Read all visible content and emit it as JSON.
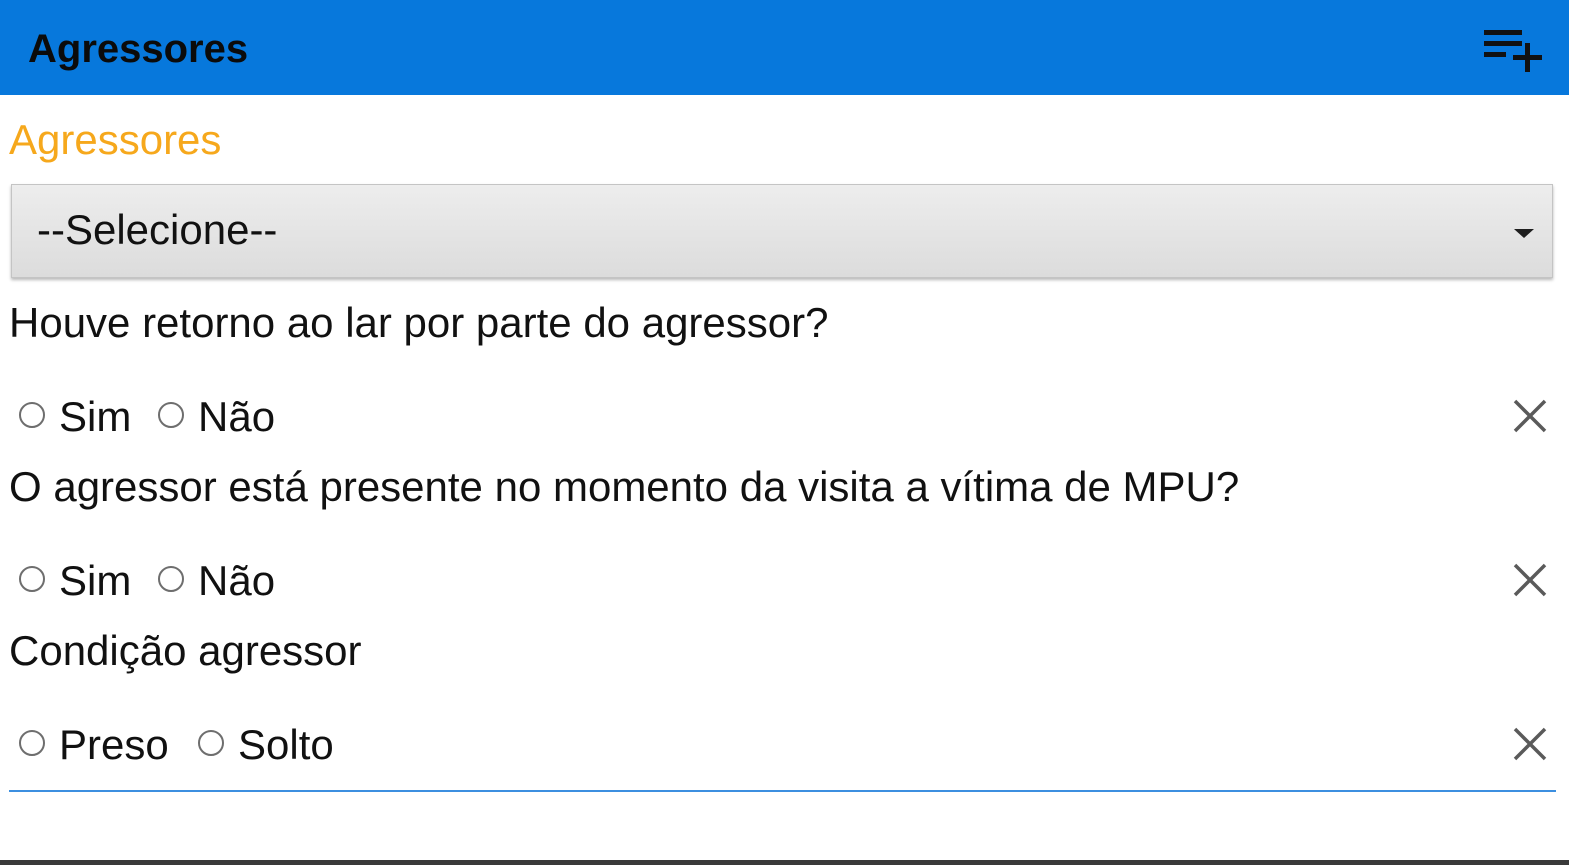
{
  "app_bar": {
    "title": "Agressores",
    "action_icon": "playlist-add-icon",
    "background_color": "#0778dc"
  },
  "section": {
    "title": "Agressores",
    "title_color": "#f6a81c"
  },
  "aggressor_select": {
    "selected": "--Selecione--"
  },
  "questions": [
    {
      "label": "Houve retorno ao lar por parte do agressor?",
      "options": [
        "Sim",
        "Não"
      ],
      "clear_icon": "close-icon"
    },
    {
      "label": "O agressor está presente no momento da visita a vítima de MPU?",
      "options": [
        "Sim",
        "Não"
      ],
      "clear_icon": "close-icon"
    },
    {
      "label": "Condição agressor",
      "options": [
        "Preso",
        "Solto"
      ],
      "clear_icon": "close-icon"
    }
  ]
}
